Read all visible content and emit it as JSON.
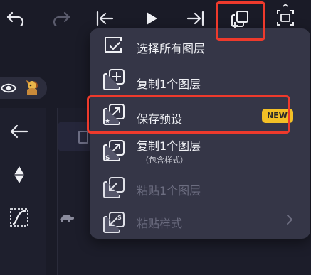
{
  "toolbar": {
    "icons": [
      "undo-icon",
      "redo-icon",
      "skip-to-start-icon",
      "play-icon",
      "skip-to-end-icon",
      "copy-layer-menu-icon",
      "fullscreen-icon"
    ]
  },
  "left_panel": {
    "icons": [
      "eye-icon",
      "layer-thumbnail",
      "back-arrow-icon",
      "keyframe-diamond-icon",
      "curve-easing-icon",
      "turtle-speed-icon"
    ]
  },
  "menu": {
    "items": [
      {
        "label": "选择所有图层",
        "icon": "select-all-layers-icon",
        "enabled": true
      },
      {
        "label": "复制1个图层",
        "icon": "duplicate-layer-icon",
        "enabled": true
      },
      {
        "label": "保存预设",
        "icon": "save-preset-icon",
        "enabled": true,
        "badge": "NEW"
      },
      {
        "label": "复制1个图层",
        "sublabel": "（包含样式）",
        "icon": "copy-layer-with-style-icon",
        "enabled": true
      },
      {
        "label": "粘贴1个图层",
        "icon": "paste-layer-icon",
        "enabled": false
      },
      {
        "label": "粘贴样式",
        "icon": "paste-style-icon",
        "enabled": false,
        "has_submenu": true
      }
    ]
  },
  "colors": {
    "background": "#1a1b27",
    "menu_bg": "#353647",
    "highlight": "#ee3a2c",
    "badge": "#f3c026"
  }
}
